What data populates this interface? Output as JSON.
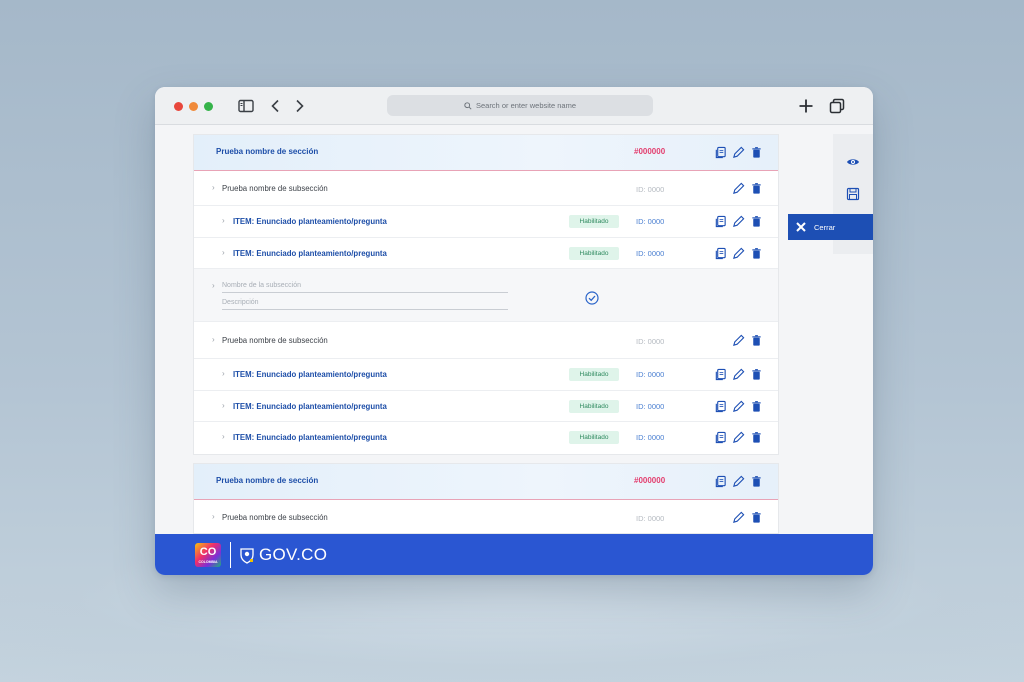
{
  "browser": {
    "url_placeholder": "Search or enter website name"
  },
  "sections": [
    {
      "title": "Prueba nombre de sección",
      "code": "#000000",
      "subsections": [
        {
          "title": "Prueba nombre de subsección",
          "id": "ID: 0000",
          "items": [
            {
              "title": "ITEM: Enunciado planteamiento/pregunta",
              "status": "Habilitado",
              "id": "ID: 0000"
            },
            {
              "title": "ITEM: Enunciado planteamiento/pregunta",
              "status": "Habilitado",
              "id": "ID: 0000"
            }
          ]
        },
        {
          "title": "Prueba nombre de subsección",
          "id": "ID: 0000",
          "items": [
            {
              "title": "ITEM: Enunciado planteamiento/pregunta",
              "status": "Habilitado",
              "id": "ID: 0000"
            },
            {
              "title": "ITEM: Enunciado planteamiento/pregunta",
              "status": "Habilitado",
              "id": "ID: 0000"
            },
            {
              "title": "ITEM: Enunciado planteamiento/pregunta",
              "status": "Habilitado",
              "id": "ID: 0000"
            }
          ]
        }
      ]
    },
    {
      "title": "Prueba nombre de sección",
      "code": "#000000",
      "subsections": [
        {
          "title": "Prueba nombre de subsección",
          "id": "ID: 0000",
          "items": []
        }
      ]
    }
  ],
  "new_subsection_form": {
    "name_placeholder": "Nombre de la subsección",
    "description_placeholder": "Descripción"
  },
  "side_panel": {
    "close_label": "Cerrar"
  },
  "footer": {
    "co_logo_text": "CO",
    "co_logo_subtext": "COLOMBIA",
    "brand": "GOV.CO"
  },
  "colors": {
    "primary_blue": "#1d4fb4",
    "section_code_pink": "#e33e6e",
    "enabled_badge_green": "#2f8a5f",
    "footer_blue": "#2a56d2"
  }
}
